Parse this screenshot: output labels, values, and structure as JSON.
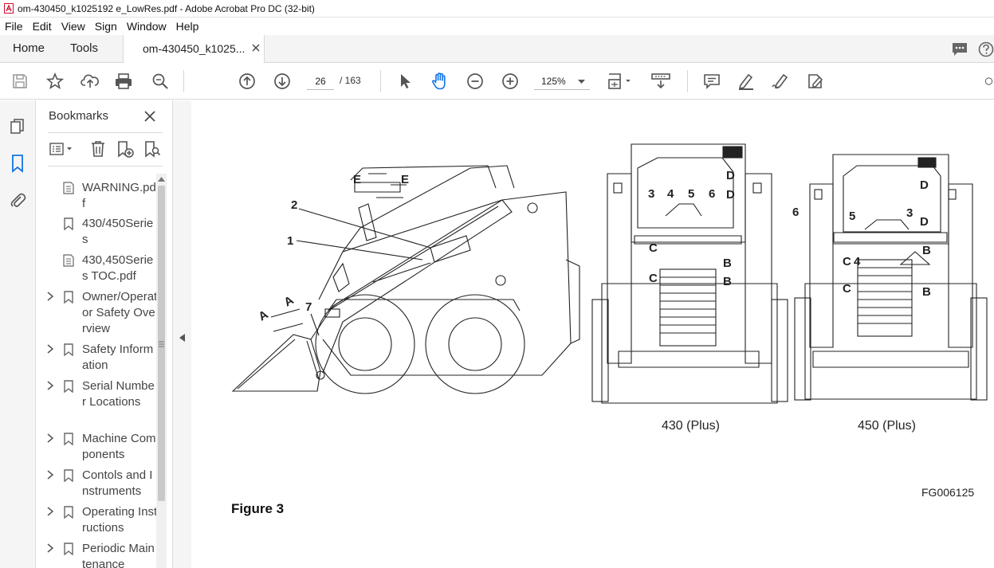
{
  "window": {
    "title": "om-430450_k1025192 e_LowRes.pdf - Adobe Acrobat Pro DC (32-bit)"
  },
  "menu": [
    "File",
    "Edit",
    "View",
    "Sign",
    "Window",
    "Help"
  ],
  "tabs": {
    "home": "Home",
    "tools": "Tools",
    "document": "om-430450_k1025...",
    "close_symbol": "×"
  },
  "toolbar": {
    "page_current": "26",
    "page_total": "/ 163",
    "zoom": "125%"
  },
  "bookmarks": {
    "title": "Bookmarks",
    "items": [
      {
        "label": "WARNING.pdf",
        "icon": "page-bookmark-icon",
        "expandable": false
      },
      {
        "label": "430/450Series",
        "icon": "bookmark-icon",
        "expandable": false
      },
      {
        "label": "430,450Series TOC.pdf",
        "icon": "page-bookmark-icon",
        "expandable": false
      },
      {
        "label": "Owner/Operator Safety Overview",
        "icon": "bookmark-icon",
        "expandable": true
      },
      {
        "label": "Safety Information",
        "icon": "bookmark-icon",
        "expandable": true
      },
      {
        "label": "Serial Number Locations",
        "icon": "bookmark-icon",
        "expandable": true
      },
      {
        "label": "Machine Components",
        "icon": "bookmark-icon",
        "expandable": true
      },
      {
        "label": "Contols and Instruments",
        "icon": "bookmark-icon",
        "expandable": true
      },
      {
        "label": "Operating Instructions",
        "icon": "bookmark-icon",
        "expandable": true
      },
      {
        "label": "Periodic Maintenance",
        "icon": "bookmark-icon",
        "expandable": true
      }
    ]
  },
  "document": {
    "figure_label": "Figure 3",
    "figure_code": "FG006125",
    "side_view_callouts": {
      "c2": "2",
      "c1": "1",
      "c7": "7",
      "cA1": "A",
      "cA2": "A",
      "cE1": "E",
      "cE2": "E"
    },
    "rear_430": {
      "caption": "430 (Plus)",
      "callouts": {
        "n3": "3",
        "n4": "4",
        "n5": "5",
        "n6": "6",
        "d1": "D",
        "d2": "D",
        "c1": "C",
        "c2": "C",
        "b1": "B",
        "b2": "B"
      }
    },
    "rear_450": {
      "caption": "450 (Plus)",
      "callouts": {
        "n6": "6",
        "n5": "5",
        "n3": "3",
        "n4": "4",
        "d1": "D",
        "d2": "D",
        "c1": "C",
        "c2": "C",
        "b1": "B",
        "b2": "B"
      }
    }
  }
}
